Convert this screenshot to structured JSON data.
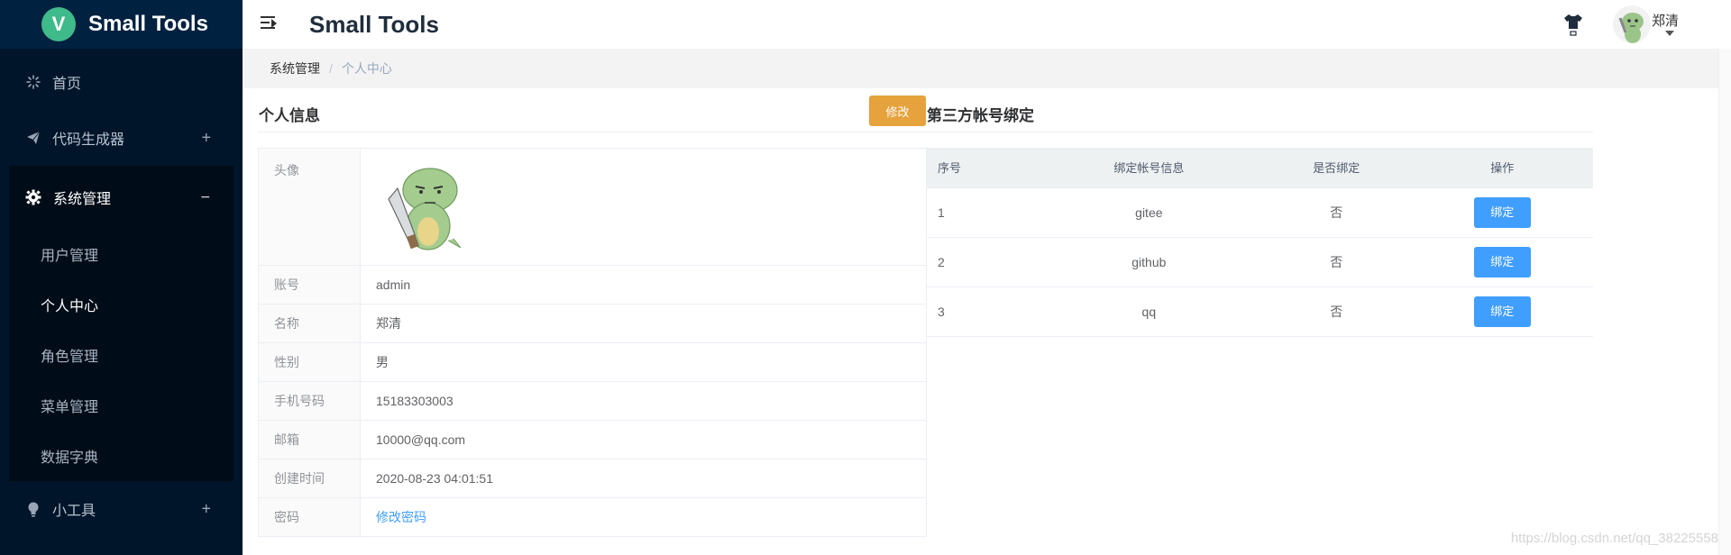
{
  "sidebar": {
    "logo_letter": "V",
    "logo_text": "Small Tools",
    "items": [
      {
        "label": "首页",
        "icon": "loading-spinner-icon"
      },
      {
        "label": "代码生成器",
        "icon": "paper-plane-icon",
        "expandable": true
      },
      {
        "label": "系统管理",
        "icon": "gear-icon",
        "expanded": true,
        "children": [
          {
            "label": "用户管理"
          },
          {
            "label": "个人中心",
            "active": true
          },
          {
            "label": "角色管理"
          },
          {
            "label": "菜单管理"
          },
          {
            "label": "数据字典"
          }
        ]
      },
      {
        "label": "小工具",
        "icon": "lightbulb-icon",
        "expandable": true
      }
    ],
    "expand_glyph": "+",
    "collapse_glyph": "−"
  },
  "header": {
    "title": "Small Tools",
    "user_name": "郑清"
  },
  "breadcrumb": {
    "items": [
      "系统管理",
      "个人中心"
    ],
    "separator": "/"
  },
  "personal_info": {
    "title": "个人信息",
    "edit_label": "修改",
    "rows": [
      {
        "label": "头像",
        "value": ""
      },
      {
        "label": "账号",
        "value": "admin"
      },
      {
        "label": "名称",
        "value": "郑清"
      },
      {
        "label": "性别",
        "value": "男"
      },
      {
        "label": "手机号码",
        "value": "15183303003"
      },
      {
        "label": "邮箱",
        "value": "10000@qq.com"
      },
      {
        "label": "创建时间",
        "value": "2020-08-23 04:01:51"
      },
      {
        "label": "密码",
        "value": "修改密码"
      }
    ]
  },
  "third_party": {
    "title": "第三方帐号绑定",
    "columns": [
      "序号",
      "绑定帐号信息",
      "是否绑定",
      "操作"
    ],
    "rows": [
      {
        "index": "1",
        "account": "gitee",
        "bound": "否",
        "action": "绑定"
      },
      {
        "index": "2",
        "account": "github",
        "bound": "否",
        "action": "绑定"
      },
      {
        "index": "3",
        "account": "qq",
        "bound": "否",
        "action": "绑定"
      }
    ]
  },
  "watermark": "https://blog.csdn.net/qq_38225558",
  "colors": {
    "sidebar_bg": "#001529",
    "primary": "#409eff",
    "warning": "#e6a23c",
    "logo_green": "#3fba8a"
  }
}
